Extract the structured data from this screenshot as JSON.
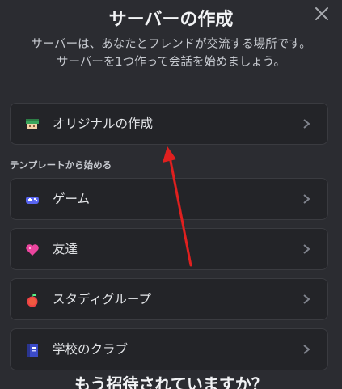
{
  "modal": {
    "title": "サーバーの作成",
    "subtitle_line1": "サーバーは、あなたとフレンドが交流する場所です。",
    "subtitle_line2": "サーバーを1つ作って会話を始めましょう。"
  },
  "options": {
    "create_own": {
      "label": "オリジナルの作成",
      "icon": "hand-build-icon"
    },
    "templates_heading": "テンプレートから始める",
    "templates": [
      {
        "label": "ゲーム",
        "icon": "gamepad-icon"
      },
      {
        "label": "友達",
        "icon": "heart-icon"
      },
      {
        "label": "スタディグループ",
        "icon": "apple-icon"
      },
      {
        "label": "学校のクラブ",
        "icon": "book-icon"
      }
    ]
  },
  "footer": {
    "heading": "もう招待されていますか？"
  },
  "colors": {
    "background": "#2b2c31",
    "card": "#232428",
    "annotation_arrow": "#e0201f"
  }
}
